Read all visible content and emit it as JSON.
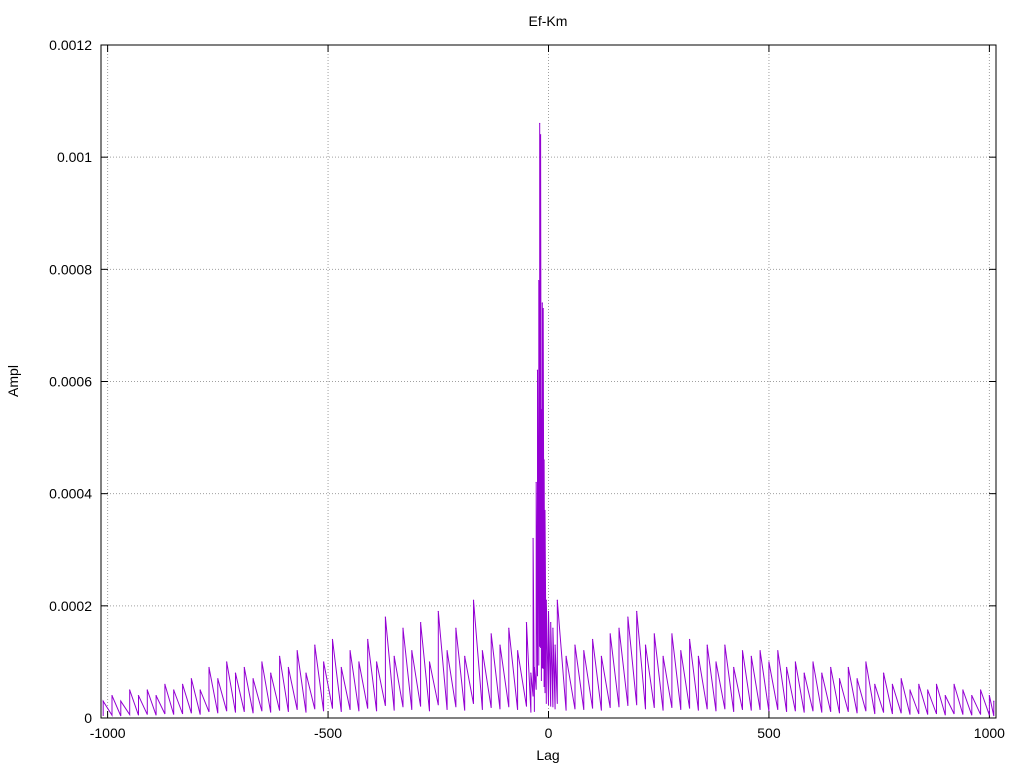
{
  "chart_data": {
    "type": "line",
    "title": "Ef-Km",
    "xlabel": "Lag",
    "ylabel": "Ampl",
    "xlim": [
      -1015,
      1015
    ],
    "ylim": [
      0,
      0.0012
    ],
    "grid": true,
    "line_color": "#9400d3",
    "x_ticks": [
      {
        "value": -1000,
        "label": "-1000"
      },
      {
        "value": -500,
        "label": "-500"
      },
      {
        "value": 0,
        "label": "0"
      },
      {
        "value": 500,
        "label": "500"
      },
      {
        "value": 1000,
        "label": "1000"
      }
    ],
    "y_ticks": [
      {
        "value": 0,
        "label": "0"
      },
      {
        "value": 0.0002,
        "label": "0.0002"
      },
      {
        "value": 0.0004,
        "label": "0.0004"
      },
      {
        "value": 0.0006,
        "label": "0.0006"
      },
      {
        "value": 0.0008,
        "label": "0.0008"
      },
      {
        "value": 0.001,
        "label": "0.001"
      },
      {
        "value": 0.0012,
        "label": "0.0012"
      }
    ],
    "series": [
      {
        "points": [
          [
            -1010,
            3e-05
          ],
          [
            -990,
            4e-05
          ],
          [
            -970,
            3e-05
          ],
          [
            -950,
            5e-05
          ],
          [
            -930,
            4e-05
          ],
          [
            -910,
            5e-05
          ],
          [
            -890,
            4e-05
          ],
          [
            -870,
            6e-05
          ],
          [
            -850,
            5e-05
          ],
          [
            -830,
            6e-05
          ],
          [
            -810,
            7e-05
          ],
          [
            -790,
            5e-05
          ],
          [
            -770,
            9e-05
          ],
          [
            -750,
            7e-05
          ],
          [
            -730,
            0.0001
          ],
          [
            -710,
            8e-05
          ],
          [
            -690,
            9e-05
          ],
          [
            -670,
            7e-05
          ],
          [
            -650,
            0.0001
          ],
          [
            -630,
            8e-05
          ],
          [
            -610,
            0.00011
          ],
          [
            -590,
            9e-05
          ],
          [
            -570,
            0.00012
          ],
          [
            -550,
            8e-05
          ],
          [
            -530,
            0.00013
          ],
          [
            -510,
            0.0001
          ],
          [
            -490,
            0.00014
          ],
          [
            -470,
            9e-05
          ],
          [
            -450,
            0.00012
          ],
          [
            -430,
            0.0001
          ],
          [
            -410,
            0.00014
          ],
          [
            -390,
            0.0001
          ],
          [
            -370,
            0.00018
          ],
          [
            -350,
            0.00011
          ],
          [
            -330,
            0.00016
          ],
          [
            -310,
            0.00012
          ],
          [
            -290,
            0.00017
          ],
          [
            -270,
            0.0001
          ],
          [
            -250,
            0.00019
          ],
          [
            -230,
            0.00012
          ],
          [
            -210,
            0.00016
          ],
          [
            -190,
            0.00011
          ],
          [
            -170,
            0.00021
          ],
          [
            -150,
            0.00012
          ],
          [
            -130,
            0.00015
          ],
          [
            -110,
            0.00013
          ],
          [
            -90,
            0.00016
          ],
          [
            -70,
            0.00012
          ],
          [
            -50,
            0.00017
          ],
          [
            -40,
            8e-05
          ],
          [
            -35,
            0.00032
          ],
          [
            -32,
            9e-05
          ],
          [
            -28,
            0.00042
          ],
          [
            -25,
            0.00062
          ],
          [
            -22,
            0.00078
          ],
          [
            -20,
            0.00106
          ],
          [
            -18,
            0.00104
          ],
          [
            -16,
            0.00055
          ],
          [
            -14,
            0.00074
          ],
          [
            -12,
            0.00073
          ],
          [
            -10,
            0.00046
          ],
          [
            -8,
            0.00037
          ],
          [
            -5,
            0.00021
          ],
          [
            0,
            0.00019
          ],
          [
            5,
            0.00017
          ],
          [
            10,
            0.00016
          ],
          [
            15,
            0.00013
          ],
          [
            20,
            0.00021
          ],
          [
            40,
            0.00011
          ],
          [
            60,
            0.00013
          ],
          [
            80,
            0.00012
          ],
          [
            100,
            0.00014
          ],
          [
            120,
            0.00011
          ],
          [
            140,
            0.00015
          ],
          [
            160,
            0.00016
          ],
          [
            180,
            0.00018
          ],
          [
            200,
            0.00019
          ],
          [
            220,
            0.00013
          ],
          [
            240,
            0.00015
          ],
          [
            260,
            0.00011
          ],
          [
            280,
            0.00015
          ],
          [
            300,
            0.00012
          ],
          [
            320,
            0.00014
          ],
          [
            340,
            0.00011
          ],
          [
            360,
            0.00013
          ],
          [
            380,
            0.0001
          ],
          [
            400,
            0.00013
          ],
          [
            420,
            9e-05
          ],
          [
            440,
            0.00012
          ],
          [
            460,
            0.00011
          ],
          [
            480,
            0.00012
          ],
          [
            500,
            0.0001
          ],
          [
            520,
            0.00012
          ],
          [
            540,
            9e-05
          ],
          [
            560,
            0.0001
          ],
          [
            580,
            8e-05
          ],
          [
            600,
            0.0001
          ],
          [
            620,
            8e-05
          ],
          [
            640,
            9e-05
          ],
          [
            660,
            7e-05
          ],
          [
            680,
            9e-05
          ],
          [
            700,
            7e-05
          ],
          [
            720,
            0.0001
          ],
          [
            740,
            6e-05
          ],
          [
            760,
            8e-05
          ],
          [
            780,
            6e-05
          ],
          [
            800,
            7e-05
          ],
          [
            820,
            5e-05
          ],
          [
            840,
            6e-05
          ],
          [
            860,
            5e-05
          ],
          [
            880,
            6e-05
          ],
          [
            900,
            4e-05
          ],
          [
            920,
            6e-05
          ],
          [
            940,
            5e-05
          ],
          [
            960,
            4e-05
          ],
          [
            980,
            5e-05
          ],
          [
            1000,
            4e-05
          ],
          [
            1010,
            3e-05
          ]
        ]
      }
    ]
  }
}
